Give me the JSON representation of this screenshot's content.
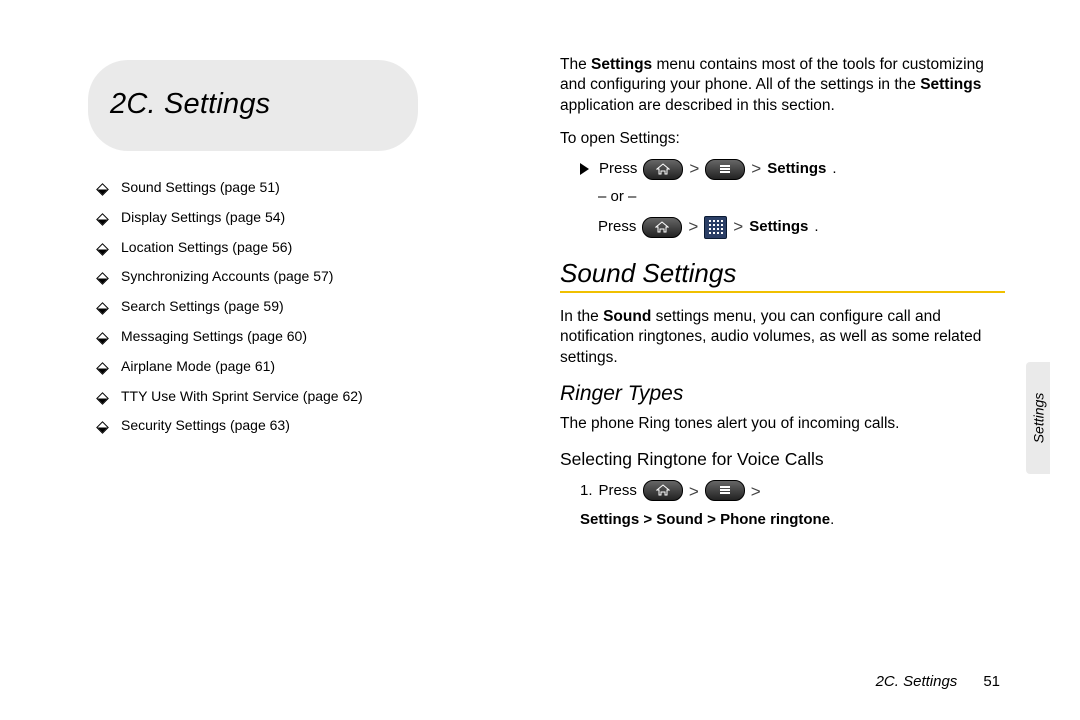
{
  "chapter": {
    "title": "2C. Settings"
  },
  "toc": [
    "Sound Settings (page 51)",
    "Display Settings (page 54)",
    "Location Settings (page 56)",
    "Synchronizing Accounts (page 57)",
    "Search Settings (page 59)",
    "Messaging Settings (page 60)",
    "Airplane Mode (page 61)",
    "TTY Use With Sprint Service (page 62)",
    "Security Settings (page 63)"
  ],
  "intro": {
    "pre1": "The ",
    "bold1": "Settings",
    "mid1": " menu contains most of the tools for customizing and configuring your phone. All of the settings in the ",
    "bold2": "Settings",
    "post1": " application are described in this section."
  },
  "open_label": "To open Settings:",
  "proc": {
    "press": "Press",
    "settings_label": "Settings",
    "or_label": "– or –",
    "period": "."
  },
  "sections": {
    "sound": {
      "title": "Sound Settings",
      "intro_pre": "In the ",
      "intro_bold": "Sound",
      "intro_post": " settings menu, you can configure call and notification ringtones, audio volumes, as well as some related settings."
    },
    "ringer": {
      "title": "Ringer Types",
      "body": "The phone Ring tones alert you of incoming calls."
    },
    "select_ringtone": {
      "title": "Selecting Ringtone for Voice Calls",
      "step_num": "1.",
      "press": "Press",
      "path1": "Settings",
      "path2": "Sound",
      "path3": "Phone ringtone",
      "sep": ">",
      "period": "."
    }
  },
  "side_tab": "Settings",
  "footer": {
    "chapter": "2C. Settings",
    "page": "51"
  }
}
